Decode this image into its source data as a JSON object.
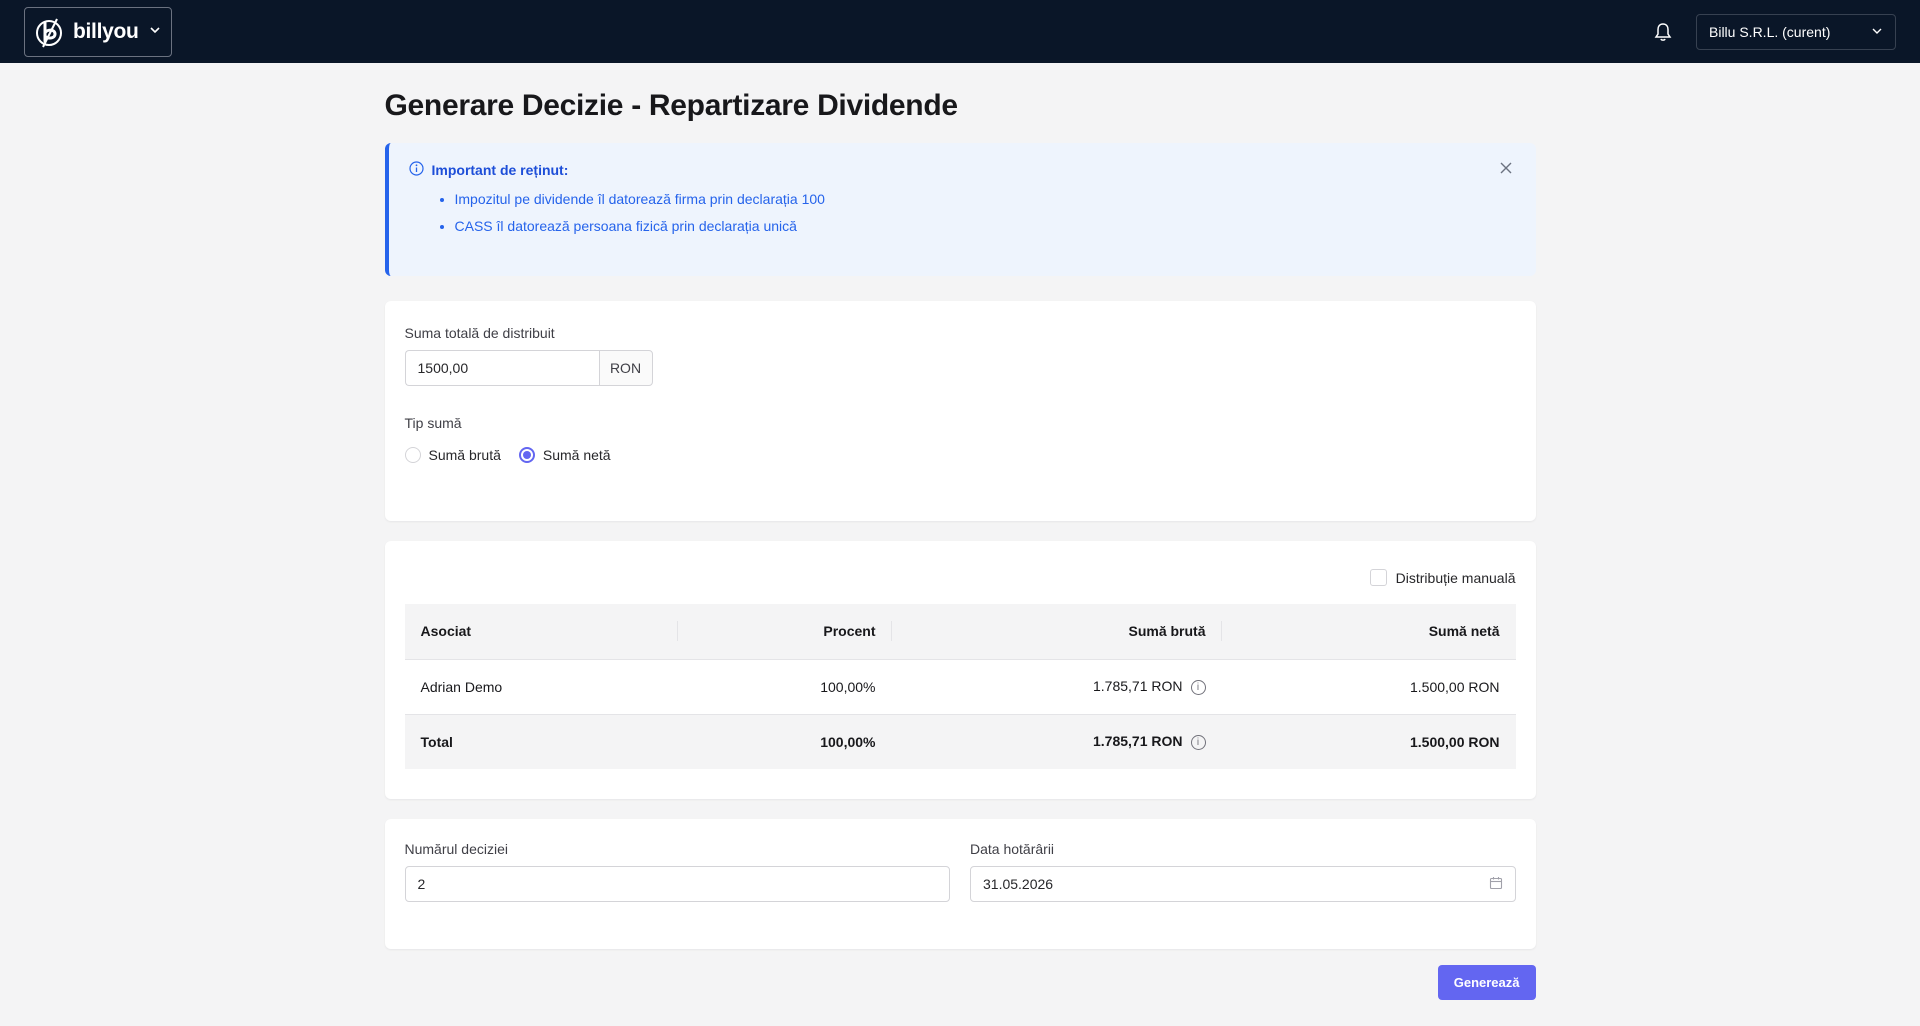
{
  "topbar": {
    "brand": "billyou",
    "company": "Billu S.R.L. (curent)"
  },
  "page": {
    "title": "Generare Decizie - Repartizare Dividende"
  },
  "alert": {
    "title": "Important de reținut:",
    "items": [
      "Impozitul pe dividende îl datorează firma prin declarația 100",
      "CASS îl datorează persoana fizică prin declarația unică"
    ]
  },
  "amount": {
    "label": "Suma totală de distribuit",
    "value": "1500,00",
    "currency": "RON",
    "type_label": "Tip sumă",
    "options": [
      {
        "label": "Sumă brută",
        "selected": false
      },
      {
        "label": "Sumă netă",
        "selected": true
      }
    ]
  },
  "distribution": {
    "manual_label": "Distribuție manuală",
    "columns": [
      "Asociat",
      "Procent",
      "Sumă brută",
      "Sumă netă"
    ],
    "rows": [
      {
        "associate": "Adrian Demo",
        "percent": "100,00%",
        "gross": "1.785,71 RON",
        "net": "1.500,00 RON"
      }
    ],
    "total": {
      "label": "Total",
      "percent": "100,00%",
      "gross": "1.785,71 RON",
      "net": "1.500,00 RON"
    }
  },
  "decision": {
    "number_label": "Numărul deciziei",
    "number_value": "2",
    "date_label": "Data hotărârii",
    "date_value": "31.05.2026"
  },
  "actions": {
    "generate_label": "Generează"
  },
  "colors": {
    "topbar": "#0a1628",
    "accent": "#6366f1",
    "alert_text": "#2563eb"
  }
}
